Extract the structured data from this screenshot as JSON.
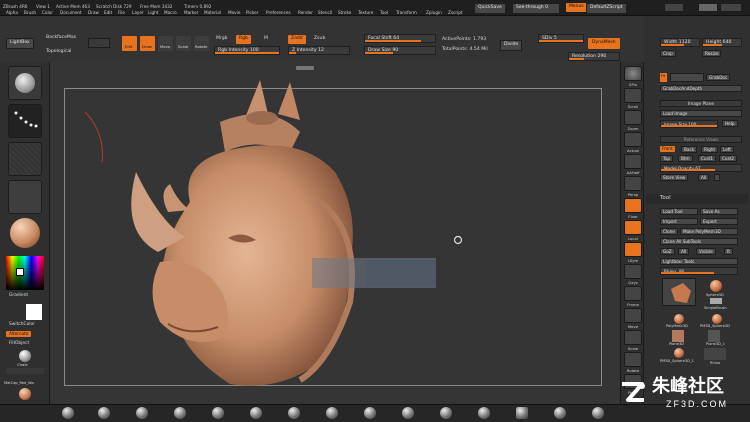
{
  "menu": {
    "left_items": [
      "ZBrush 4R6",
      "View 1",
      "Active Mem 463",
      "Scratch Disk 729",
      "Free Mem 3432",
      "Timers 0.892"
    ],
    "nav_items": [
      "Alpha",
      "Brush",
      "Color",
      "Document",
      "Draw",
      "Edit",
      "File",
      "Layer",
      "Light",
      "Macro",
      "Marker",
      "Material",
      "Movie",
      "Picker",
      "Preferences",
      "Render",
      "Stencil",
      "Stroke",
      "Texture",
      "Tool",
      "Transform",
      "Zplugin",
      "Zscript"
    ],
    "quicksave": "QuickSave",
    "seethrough": "See-through 0",
    "menus_btn": "Menus",
    "default_zscript": "DefaultZScript"
  },
  "topbar": {
    "lightbox": "LightBox",
    "backface": "BackfaceMas",
    "topological": "Topological",
    "edit": "Edit",
    "draw": "Draw",
    "move": "Move",
    "scale": "Scale",
    "rotate": "Rotate",
    "mrgb": "Mrgb",
    "rgb": "Rgb",
    "m": "M",
    "rgb_intensity": "Rgb Intensity 100",
    "zadd": "Zadd",
    "zsub": "Zsub",
    "z_intensity": "Z Intensity 12",
    "focal_shift": "Focal Shift 64",
    "draw_size": "Draw Size 90",
    "active_points": "ActivePoints: 1.793",
    "total_points": "TotalPoints: 4.54 Mil",
    "divide": "Divide",
    "sdiv": "SDiv 5",
    "dynamesh": "DynaMesh",
    "resolution": "Resolution 296"
  },
  "leftshelf": {
    "gradient": "Gradient",
    "switch_color": "SwitchColor",
    "alternate": "Alternate",
    "fill_object": "FillObject",
    "chalk": "Chalk",
    "matcap_label": "MatCap_Red_Wa"
  },
  "rightshelf": {
    "items": [
      "SPix",
      "Scroll",
      "Zoom",
      "Actual",
      "AAHalf",
      "Persp",
      "Floor",
      "Local",
      "LSym",
      "Gxyz",
      "Frame",
      "Move",
      "Scale",
      "Rotate",
      "PolyF",
      "Transp",
      "Solo",
      "Xpose"
    ]
  },
  "panel": {
    "width": "Width 1120",
    "height": "Height 640",
    "crop": "Crop",
    "resize": "Resize",
    "fit": "Fit",
    "grab_doc": "GrabDoc",
    "grab_doc_depth": "GrabDocAndDepth",
    "image_plane": "Image Plane",
    "load_image": "Load Image",
    "image_size": "Image Size 100",
    "help": "Help",
    "reference_views": "Reference Views",
    "front": "Front",
    "back": "Back",
    "right": "Right",
    "left": "Left",
    "top": "Top",
    "btm": "Btm",
    "cust1": "Cust1",
    "cust2": "Cust2",
    "model_opacity": "Model Opacity 67",
    "store_view": "Store View",
    "all": "All",
    "tool": "Tool",
    "load_tool": "Load Tool",
    "save_as": "Save As",
    "import": "Import",
    "export": "Export",
    "clone": "Clone",
    "make_polymesh": "Make PolyMesh3D",
    "clone_all_subtools": "Clone All SubTools",
    "goz": "GoZ",
    "all2": "All",
    "visible": "Visible",
    "r": "R",
    "lightbox_tools": "Lightbox› Tools",
    "rhino": "Rhino. 48",
    "sphere3d": "Sphere3D",
    "simple_brush": "SimpleBrush",
    "polymesh3d": "PolyMesh3D",
    "pm3d_sphere3d": "PM3D_Sphere3D",
    "plane3d": "Plane3D",
    "plane3d_1": "Plane3D_1",
    "pm3d_sphere3d_1": "PM3D_Sphere3D_1",
    "rhino_thumb": "Rhino"
  },
  "watermark": {
    "cn": "朱峰社区",
    "url": "ZF3D.COM"
  },
  "colors": {
    "accent": "#e8731e",
    "background": "#2a2a2a",
    "viewport": "#353535"
  }
}
